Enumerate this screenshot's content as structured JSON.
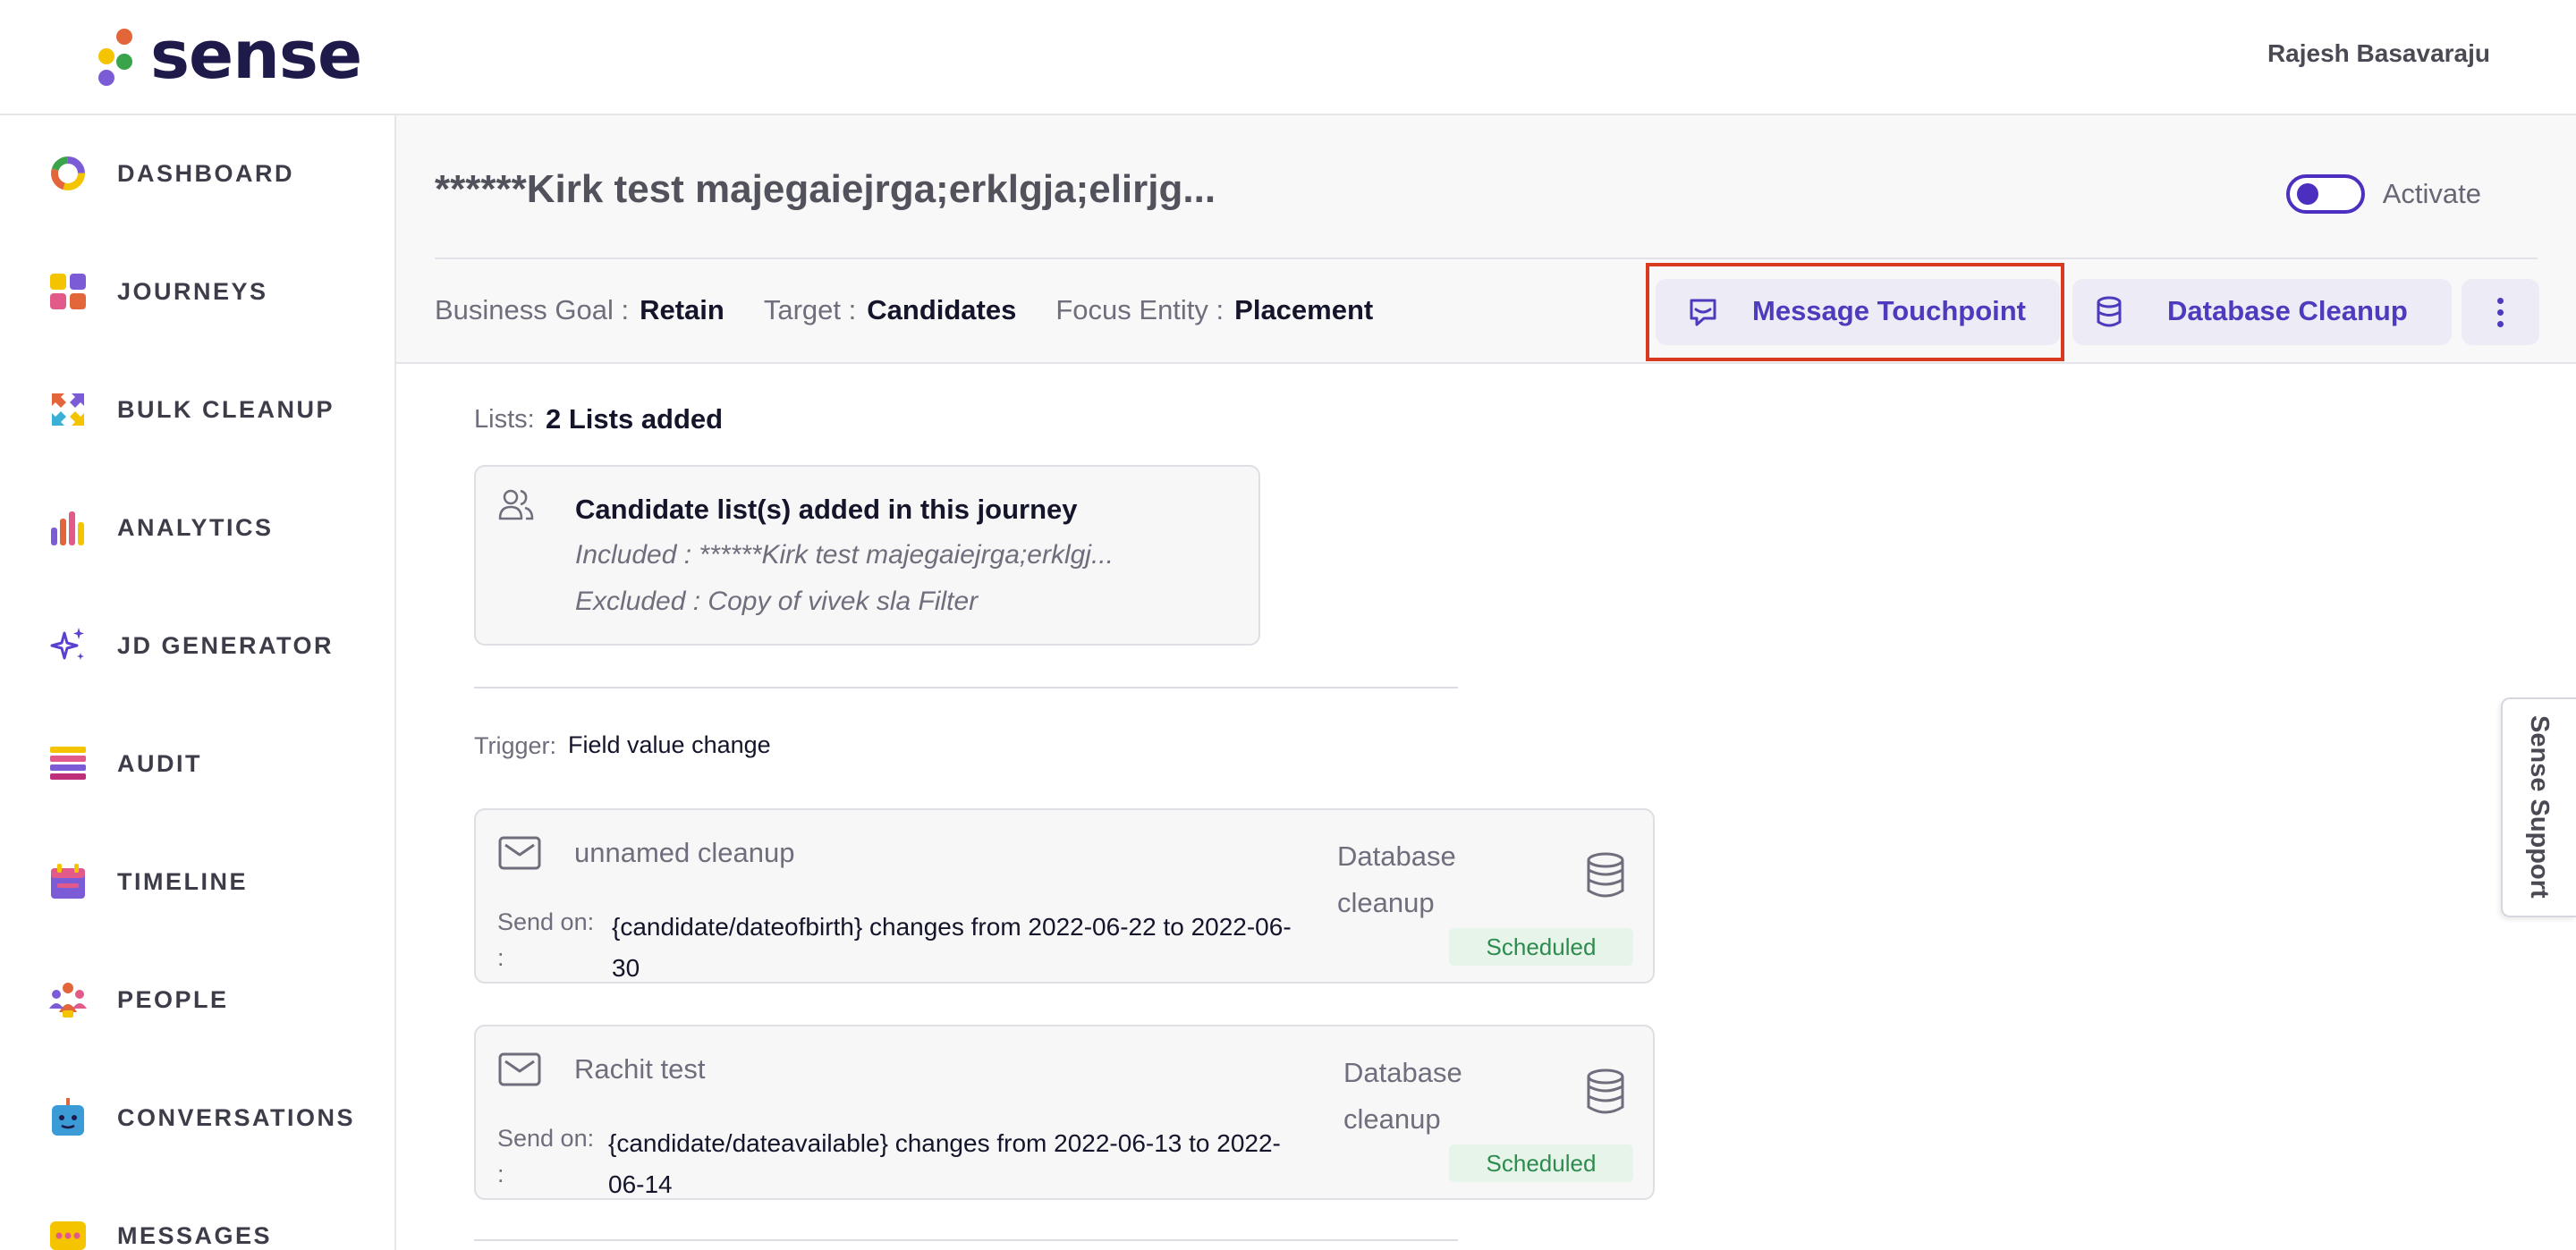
{
  "header": {
    "brand": "sense",
    "brand_dot_colors": [
      "#f5c400",
      "#e2663a",
      "#3aa44b",
      "#7c5cd6"
    ],
    "user_name": "Rajesh Basavaraju"
  },
  "sidebar": {
    "items": [
      {
        "label": "DASHBOARD",
        "icon": "dashboard-ring-icon"
      },
      {
        "label": "JOURNEYS",
        "icon": "journeys-grid-icon"
      },
      {
        "label": "BULK CLEANUP",
        "icon": "bulk-cleanup-arrows-icon"
      },
      {
        "label": "ANALYTICS",
        "icon": "analytics-bars-icon"
      },
      {
        "label": "JD GENERATOR",
        "icon": "sparkles-icon"
      },
      {
        "label": "AUDIT",
        "icon": "audit-list-icon"
      },
      {
        "label": "TIMELINE",
        "icon": "calendar-icon"
      },
      {
        "label": "PEOPLE",
        "icon": "people-icon"
      },
      {
        "label": "CONVERSATIONS",
        "icon": "robot-icon"
      },
      {
        "label": "MESSAGES",
        "icon": "messages-icon"
      }
    ]
  },
  "journey": {
    "title": "******Kirk test majegaiejrga;erklgja;elirjg...",
    "activate_label": "Activate",
    "meta": {
      "goal_key": "Business Goal :",
      "goal_val": "Retain",
      "target_key": "Target :",
      "target_val": "Candidates",
      "focus_key": "Focus Entity :",
      "focus_val": "Placement"
    },
    "actions": {
      "message_touchpoint": "Message Touchpoint",
      "database_cleanup": "Database Cleanup"
    },
    "lists": {
      "label": "Lists:",
      "value": "2 Lists added",
      "card_title": "Candidate list(s) added in this journey",
      "included": "Included : ******Kirk test majegaiejrga;erklgj...",
      "excluded": "Excluded : Copy of vivek sla Filter"
    },
    "trigger": {
      "label": "Trigger:",
      "value": "Field value change"
    },
    "touchpoints": [
      {
        "name": "unnamed cleanup",
        "send_on_label": "Send on:",
        "colon": ":",
        "condition": "{candidate/dateofbirth} changes from 2022-06-22 to 2022-06-30",
        "type": "Database cleanup",
        "status": "Scheduled"
      },
      {
        "name": "Rachit test",
        "send_on_label": "Send on:",
        "colon": ":",
        "condition": "{candidate/dateavailable} changes from 2022-06-13 to 2022-06-14",
        "type": "Database cleanup",
        "status": "Scheduled"
      }
    ]
  },
  "support_tab": "Sense Support",
  "colors": {
    "accent": "#4c3bbd",
    "highlight_outline": "#d93a1f",
    "status_green": "#2e8b4e"
  }
}
